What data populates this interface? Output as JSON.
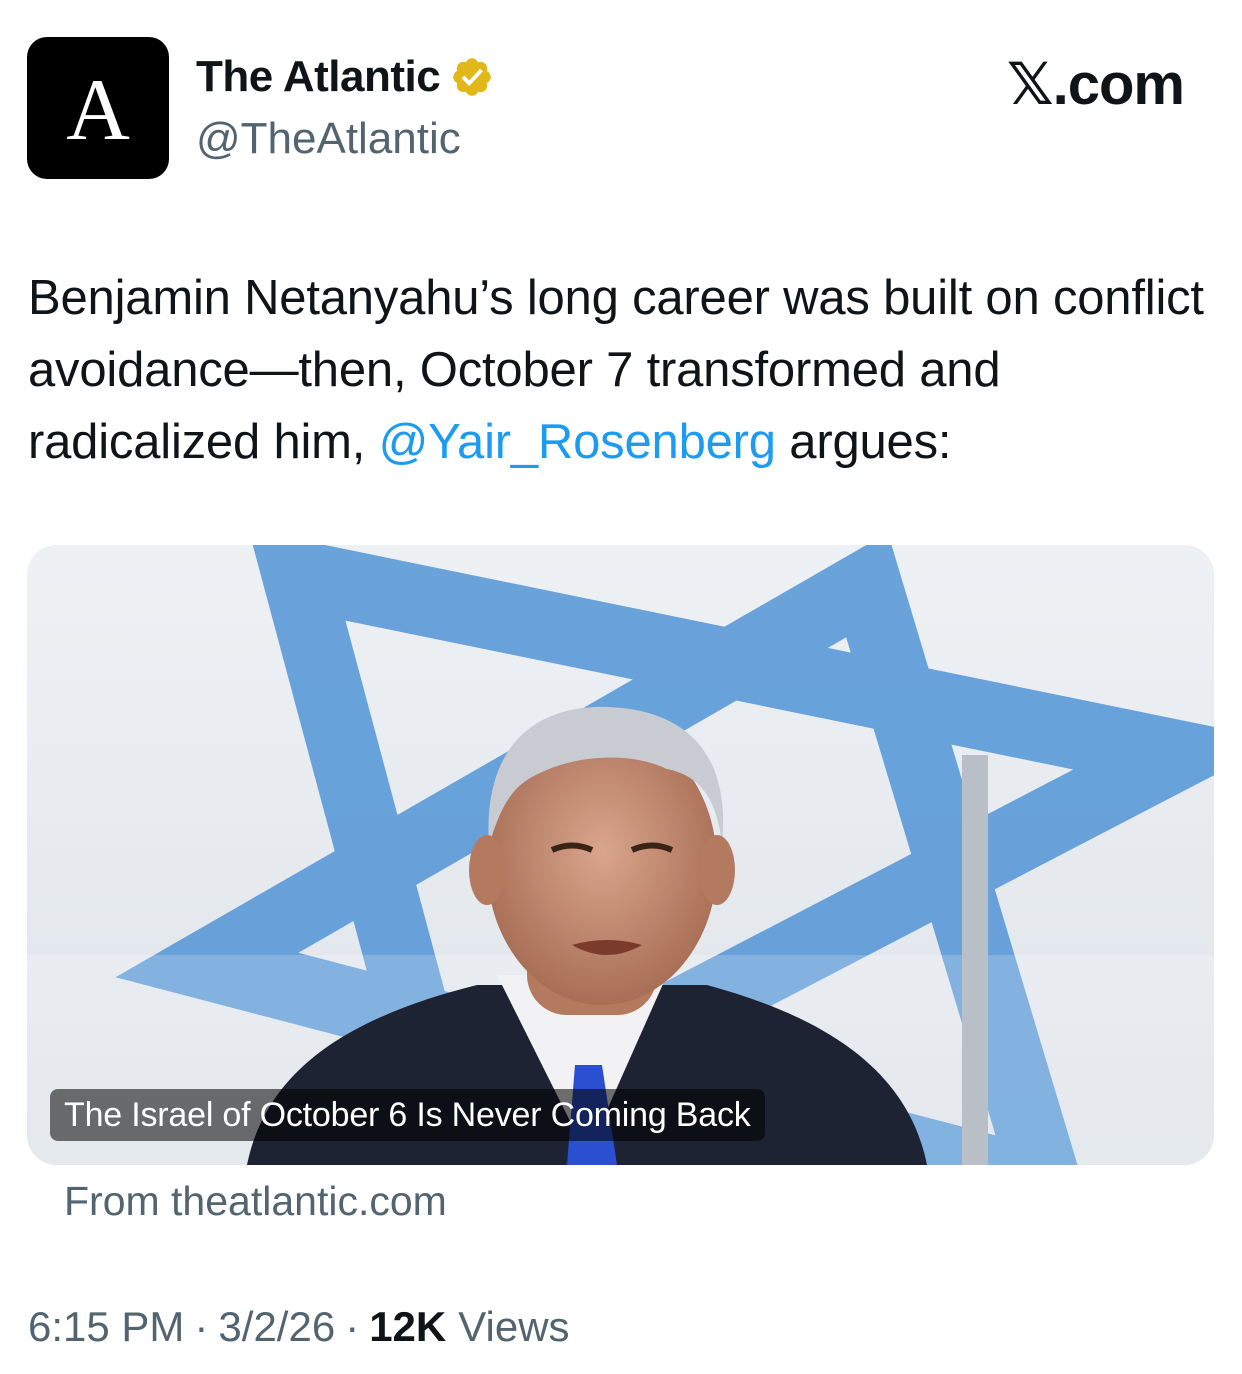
{
  "author": {
    "avatar_letter": "A",
    "display_name": "The Atlantic",
    "handle": "@TheAtlantic",
    "verified_icon": "verified-badge-icon"
  },
  "brand": "𝕏.com",
  "tweet": {
    "text_before": "Benjamin Netanyahu’s long career was built on conflict avoidance—then, October 7 transformed and radicalized him, ",
    "mention": "@Yair_Rosenberg",
    "text_after": " argues:"
  },
  "card": {
    "title": "The Israel of October 6 Is Never Coming Back",
    "source": "From theatlantic.com"
  },
  "meta": {
    "time": "6:15 PM",
    "separator": "·",
    "date": "3/2/26",
    "views_count": "12K",
    "views_label": "Views"
  },
  "colors": {
    "mention": "#1d9bf0",
    "secondary_text": "#536471",
    "verified_gold": "#e2b719",
    "flag_blue": "#5b9ad8"
  }
}
